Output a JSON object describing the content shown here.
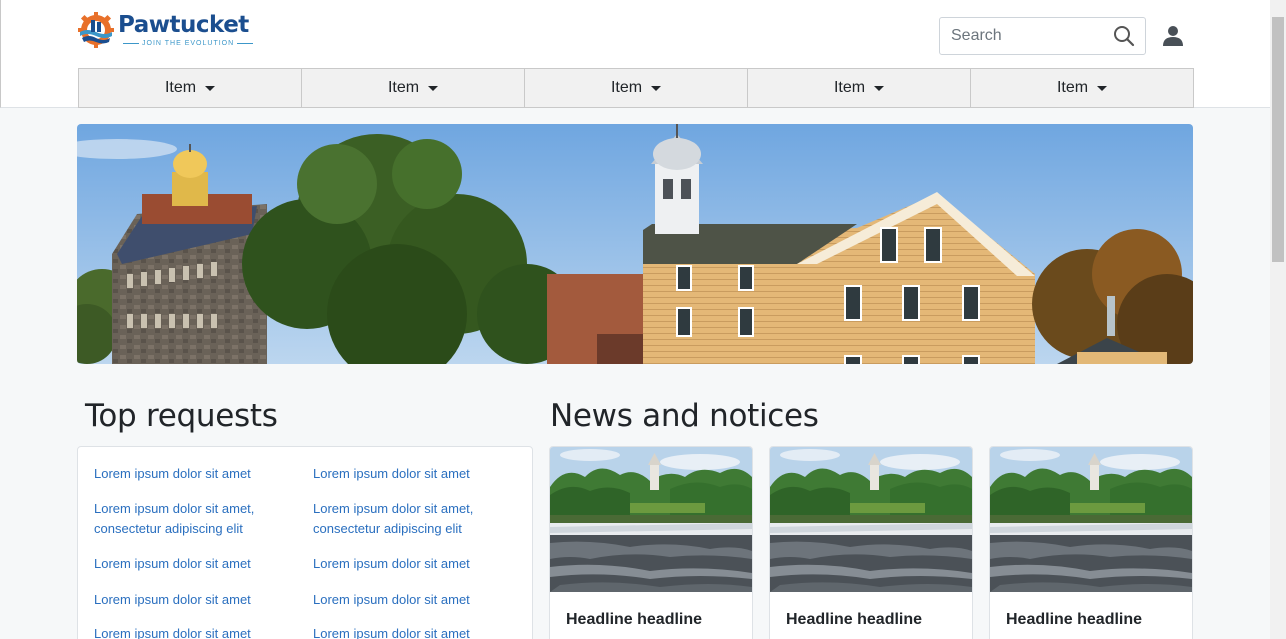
{
  "brand": {
    "name": "Pawtucket",
    "tagline": "JOIN THE EVOLUTION",
    "colors": {
      "primary": "#1b4e8f",
      "accent": "#e8702a",
      "wave": "#3c97c9"
    }
  },
  "header": {
    "search": {
      "placeholder": "Search",
      "value": "",
      "icon": "search-icon"
    },
    "user": {
      "icon": "user-icon"
    }
  },
  "nav": {
    "items": [
      {
        "label": "Item"
      },
      {
        "label": "Item"
      },
      {
        "label": "Item"
      },
      {
        "label": "Item"
      },
      {
        "label": "Item"
      }
    ]
  },
  "hero": {
    "image": "historic-mill-buildings-photo"
  },
  "top_requests": {
    "title": "Top requests",
    "links": [
      "Lorem ipsum dolor sit amet",
      "Lorem ipsum dolor sit amet",
      "Lorem ipsum dolor sit amet,",
      "consectetur adipiscing elit",
      "Lorem ipsum dolor sit amet,",
      "consectetur adipiscing elit",
      "Lorem ipsum dolor sit amet",
      "Lorem ipsum dolor sit amet",
      "Lorem ipsum dolor sit amet",
      "Lorem ipsum dolor sit amet",
      "Lorem ipsum dolor sit amet",
      "Lorem ipsum dolor sit amet"
    ]
  },
  "news": {
    "title": "News and notices",
    "cards": [
      {
        "headline": "Headline headline",
        "image": "river-dam-photo"
      },
      {
        "headline": "Headline headline",
        "image": "river-dam-photo"
      },
      {
        "headline": "Headline headline",
        "image": "river-dam-photo"
      }
    ]
  }
}
